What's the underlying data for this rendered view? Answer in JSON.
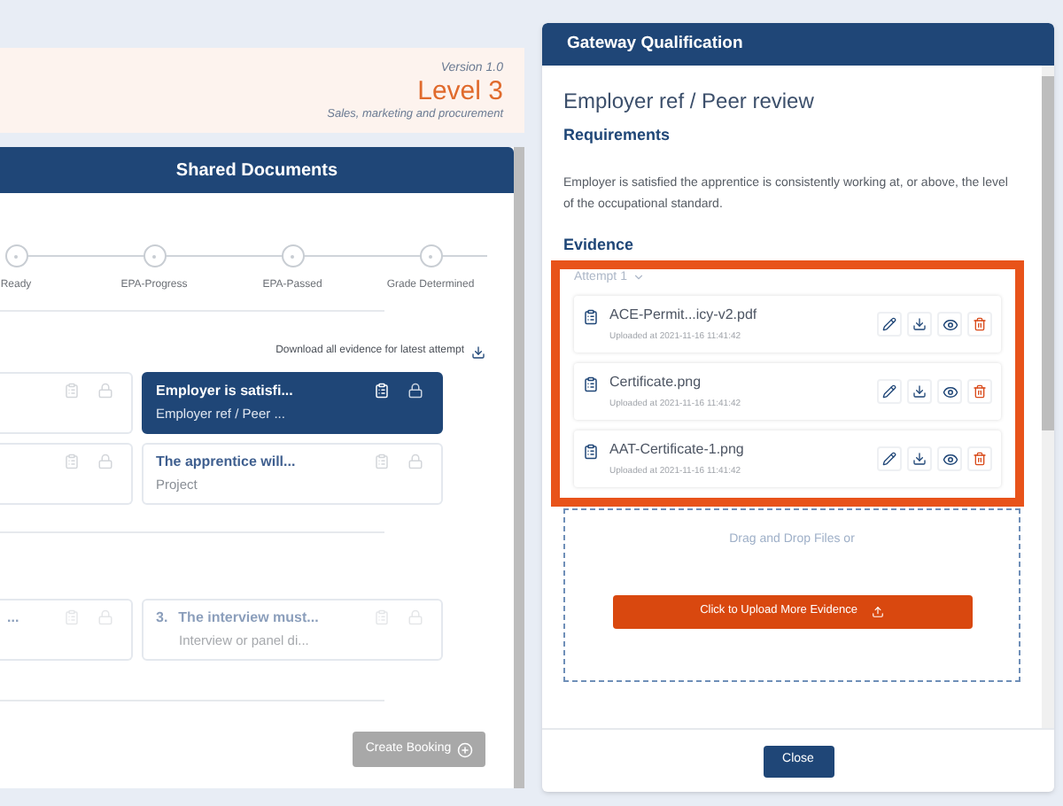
{
  "page_header": {
    "version": "Version 1.0",
    "level": "Level 3",
    "subtitle": "Sales, marketing and procurement"
  },
  "shared_documents": {
    "title": "Shared Documents",
    "steps": [
      {
        "label": "Ready"
      },
      {
        "label": "EPA-Progress"
      },
      {
        "label": "EPA-Passed"
      },
      {
        "label": "Grade Determined"
      }
    ],
    "download_link": "Download all evidence for latest attempt",
    "rows": [
      {
        "cards": [
          {
            "selected": false,
            "disabled": false
          },
          {
            "title": "Employer is satisfi...",
            "subtitle": "Employer ref / Peer ...",
            "selected": true,
            "disabled": false
          }
        ]
      },
      {
        "cards": [
          {
            "selected": false,
            "disabled": false
          },
          {
            "title": "The apprentice will...",
            "subtitle": "Project",
            "selected": false,
            "disabled": false
          }
        ]
      },
      {
        "cards": [
          {
            "title": "...",
            "selected": false,
            "disabled": true
          },
          {
            "number": "3.",
            "title": "The interview must...",
            "subtitle": "Interview or panel di...",
            "selected": false,
            "disabled": true
          }
        ]
      }
    ],
    "button": "Create Booking"
  },
  "dialog": {
    "title": "Gateway Qualification",
    "heading": "Employer ref / Peer review",
    "requirements_heading": "Requirements",
    "requirements_text": "Employer is satisfied the apprentice is consistently working at, or above, the level of the occupational standard.",
    "evidence_heading": "Evidence",
    "attempt": "Attempt 1",
    "highlighted": true,
    "files": [
      {
        "name": "ACE-Permit...icy-v2.pdf",
        "uploaded": "Uploaded at 2021-11-16 11:41:42"
      },
      {
        "name": "Certificate.png",
        "uploaded": "Uploaded at 2021-11-16 11:41:42"
      },
      {
        "name": "AAT-Certificate-1.png",
        "uploaded": "Uploaded at 2021-11-16 11:41:42"
      }
    ],
    "dropzone_text": "Drag and Drop Files or",
    "upload_button": "Click to Upload More Evidence",
    "close_button": "Close"
  }
}
